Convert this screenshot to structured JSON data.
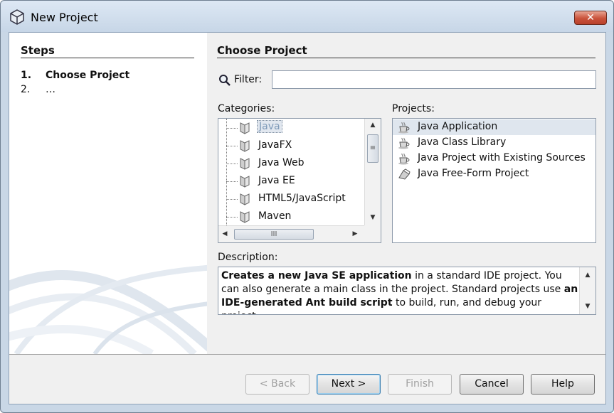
{
  "window": {
    "title": "New Project",
    "close_label": "✕"
  },
  "steps": {
    "title": "Steps",
    "items": [
      {
        "num": "1.",
        "label": "Choose Project",
        "current": true
      },
      {
        "num": "2.",
        "label": "…",
        "current": false
      }
    ]
  },
  "main": {
    "section_title": "Choose Project",
    "filter": {
      "label": "Filter:",
      "value": "",
      "placeholder": ""
    },
    "categories": {
      "label": "Categories:",
      "items": [
        "Java",
        "JavaFX",
        "Java Web",
        "Java EE",
        "HTML5/JavaScript",
        "Maven"
      ],
      "selected": "Java",
      "scroll_thumb_glyph": "≡",
      "hscroll_thumb_glyph": "III"
    },
    "projects": {
      "label": "Projects:",
      "items": [
        {
          "label": "Java Application",
          "icon": "coffee-cup-icon"
        },
        {
          "label": "Java Class Library",
          "icon": "coffee-cup-icon"
        },
        {
          "label": "Java Project with Existing Sources",
          "icon": "coffee-cup-icon"
        },
        {
          "label": "Java Free-Form Project",
          "icon": "free-form-project-icon"
        }
      ],
      "selected": "Java Application"
    },
    "description": {
      "label": "Description:",
      "bold1": "Creates a new Java SE application",
      "text1": " in a standard IDE project. You can also generate a main class in the project. Standard projects use ",
      "bold2": "an IDE-generated Ant build script",
      "text2": " to build, run, and debug your project."
    }
  },
  "buttons": {
    "back": "< Back",
    "next": "Next >",
    "finish": "Finish",
    "cancel": "Cancel",
    "help": "Help"
  },
  "colors": {
    "selection": "#dfe6ee",
    "titlebar": "#c9d7e6",
    "close_button": "#c9523b"
  }
}
